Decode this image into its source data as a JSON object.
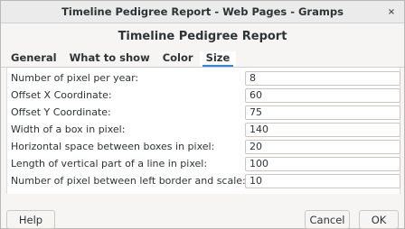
{
  "window": {
    "title": "Timeline Pedigree Report - Web Pages - Gramps",
    "close_glyph": "×"
  },
  "header": {
    "title": "Timeline Pedigree Report"
  },
  "tabs": [
    {
      "label": "General"
    },
    {
      "label": "What to show"
    },
    {
      "label": "Color"
    },
    {
      "label": "Size"
    }
  ],
  "active_tab": "Size",
  "fields": [
    {
      "label": "Number of pixel per year:",
      "value": "8"
    },
    {
      "label": "Offset X Coordinate:",
      "value": "60"
    },
    {
      "label": "Offset Y Coordinate:",
      "value": "75"
    },
    {
      "label": "Width of a box in pixel:",
      "value": "140"
    },
    {
      "label": "Horizontal space between boxes in pixel:",
      "value": "20"
    },
    {
      "label": "Length of vertical part of a line in pixel:",
      "value": "100"
    },
    {
      "label": "Number of pixel between left border and scale:",
      "value": "10"
    }
  ],
  "buttons": {
    "help": "Help",
    "cancel": "Cancel",
    "ok": "OK"
  },
  "colors": {
    "accent": "#3584e4"
  }
}
